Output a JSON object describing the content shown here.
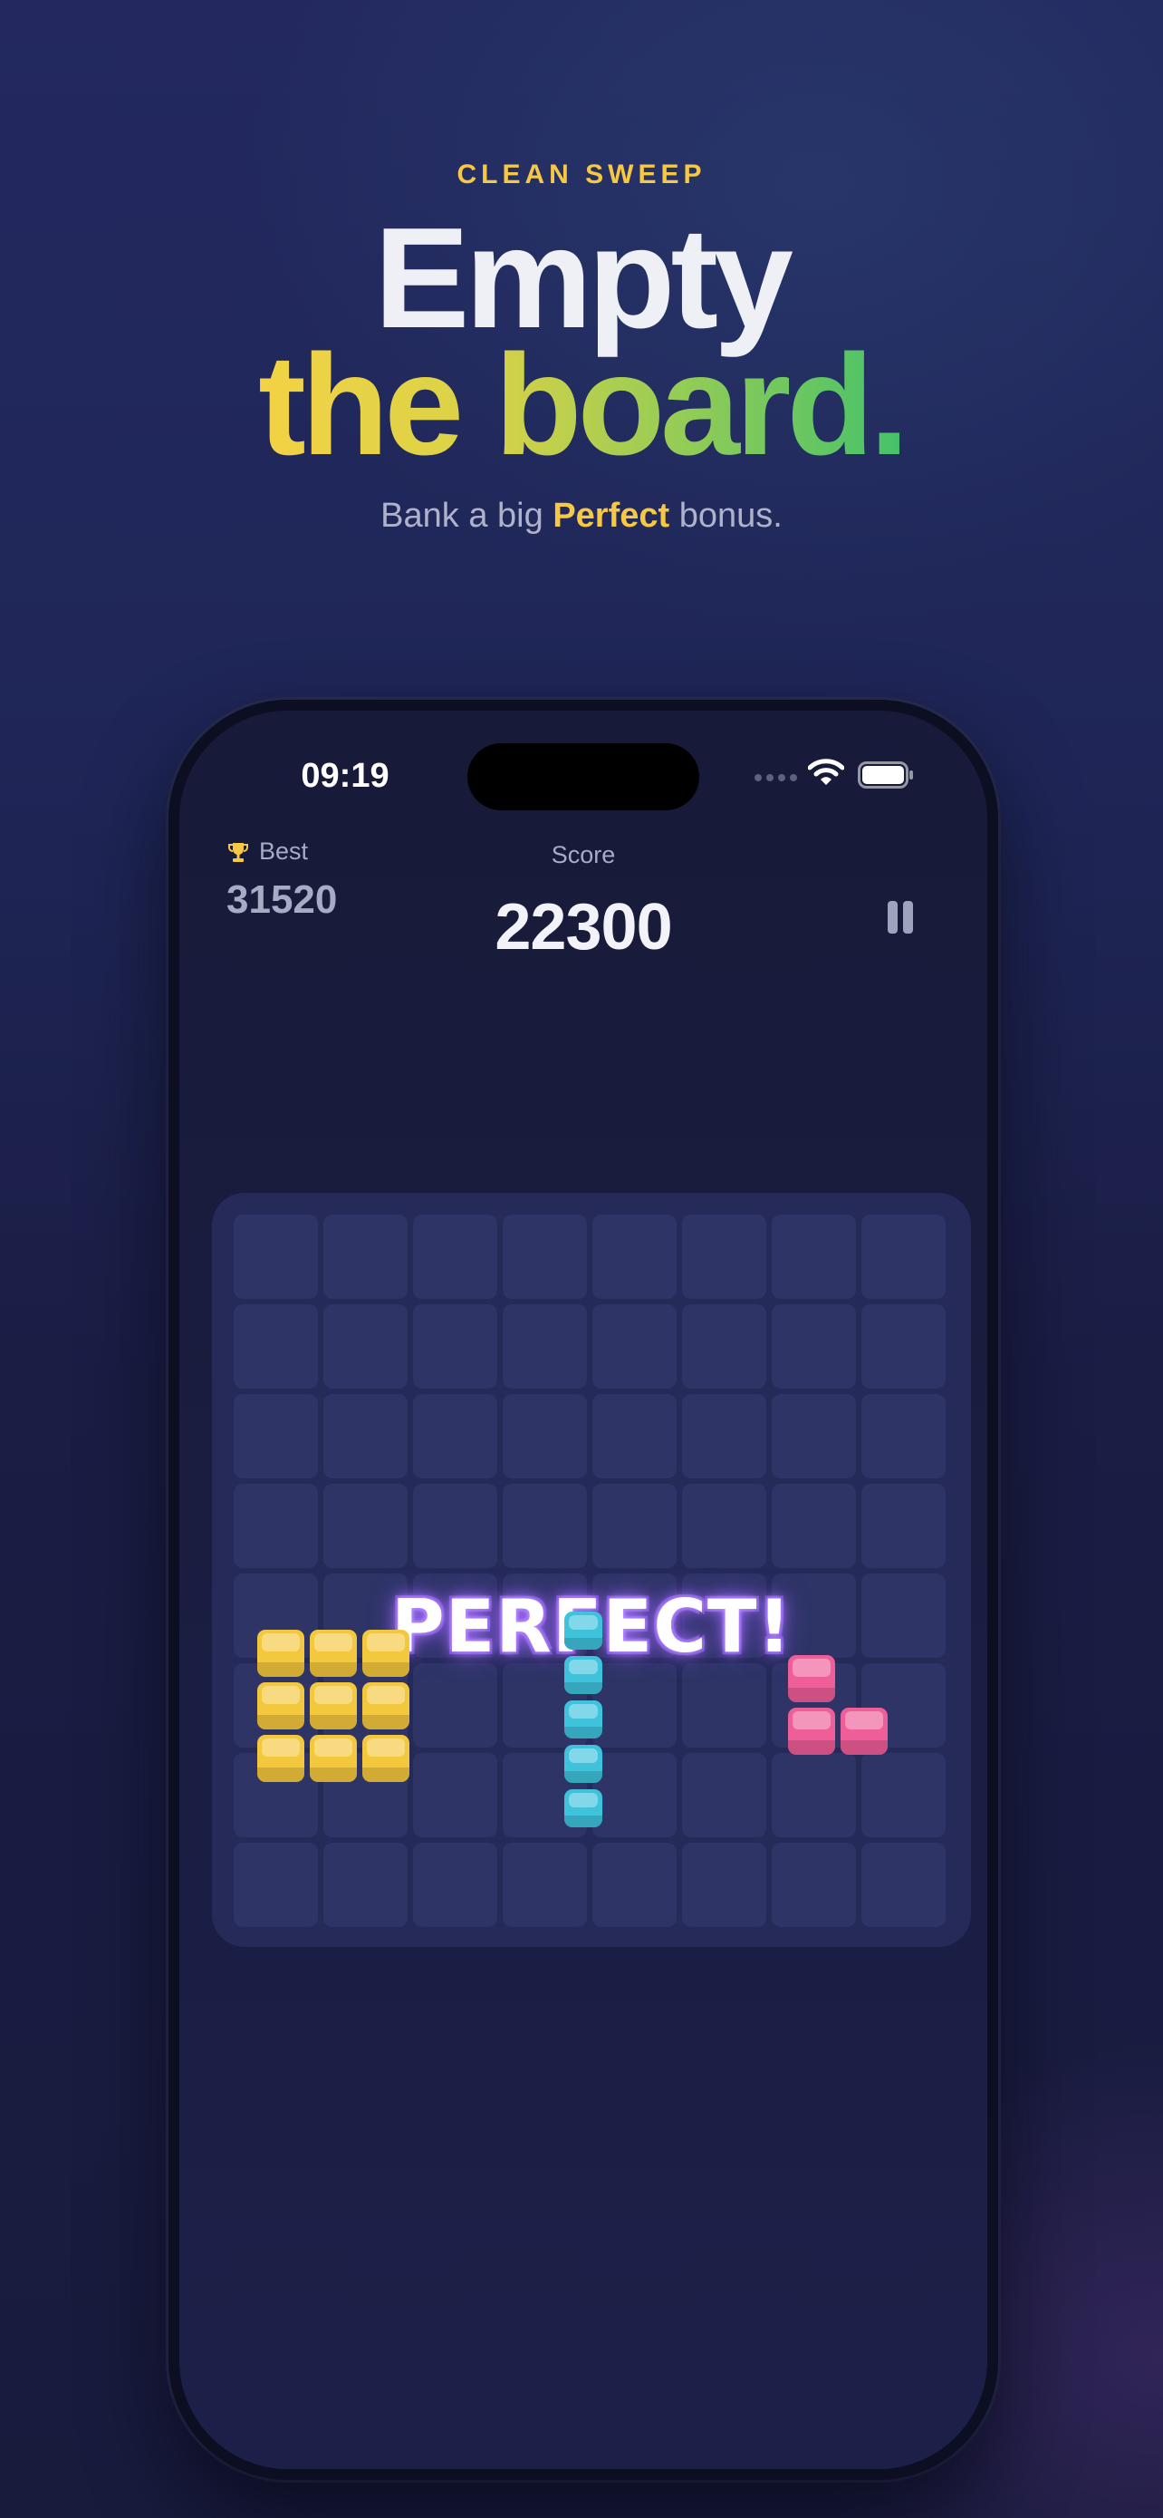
{
  "promo": {
    "eyebrow": "CLEAN SWEEP",
    "headline_line1": "Empty",
    "headline_line2": "the board.",
    "subline_prefix": "Bank a big",
    "subline_highlight": "Perfect",
    "subline_suffix": "bonus."
  },
  "status_bar": {
    "time": "09:19",
    "icons": [
      "cellular-dots-icon",
      "wifi-icon",
      "battery-icon"
    ]
  },
  "hud": {
    "best_label": "Best",
    "best_value": "31520",
    "best_icon": "trophy-icon",
    "score_label": "Score",
    "score_value": "22300",
    "pause_icon": "pause-icon"
  },
  "board": {
    "rows": 8,
    "columns": 8,
    "overlay_text": "PERFECT!"
  },
  "pieces": [
    {
      "name": "square-3x3",
      "color": "#f4c83c",
      "cells": [
        [
          0,
          0
        ],
        [
          0,
          1
        ],
        [
          0,
          2
        ],
        [
          1,
          0
        ],
        [
          1,
          1
        ],
        [
          1,
          2
        ],
        [
          2,
          0
        ],
        [
          2,
          1
        ],
        [
          2,
          2
        ]
      ]
    },
    {
      "name": "line-vertical-5",
      "color": "#3fc2dc",
      "cells": [
        [
          0,
          0
        ],
        [
          1,
          0
        ],
        [
          2,
          0
        ],
        [
          3,
          0
        ],
        [
          4,
          0
        ]
      ]
    },
    {
      "name": "l-corner-3",
      "color": "#ee5e98",
      "cells": [
        [
          0,
          0
        ],
        [
          1,
          0
        ],
        [
          1,
          1
        ]
      ]
    }
  ],
  "colors": {
    "accent_yellow": "#f7c843",
    "board_bg": "#252a59",
    "cell_bg": "#2e3466",
    "glow_purple": "#a872ff"
  }
}
